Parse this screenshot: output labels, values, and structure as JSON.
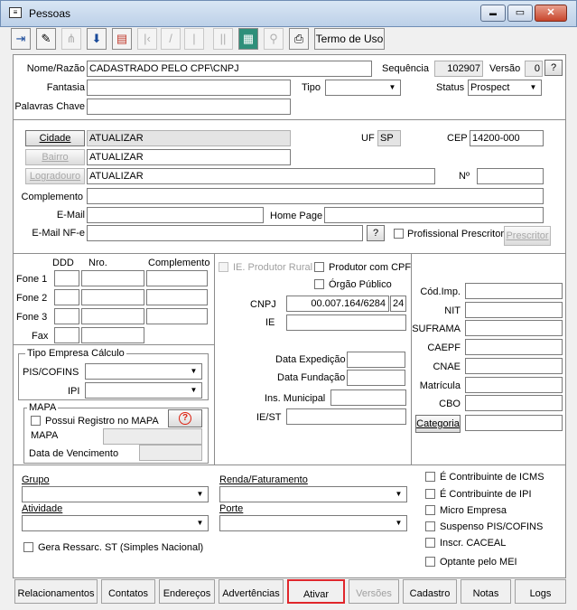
{
  "window": {
    "title": "Pessoas",
    "min": "▬",
    "max": "▭",
    "close": "✕"
  },
  "toolbar": {
    "termo_label": "Termo de Uso"
  },
  "identity": {
    "nome_label": "Nome/Razão",
    "nome_value": "CADASTRADO PELO CPF\\CNPJ",
    "sequencia_label": "Sequência",
    "sequencia_value": "102907",
    "versao_label": "Versão",
    "versao_value": "0",
    "help_label": "?",
    "fantasia_label": "Fantasia",
    "tipo_label": "Tipo",
    "status_label": "Status",
    "status_value": "Prospect",
    "palavras_label": "Palavras Chave"
  },
  "address": {
    "cidade_btn": "Cidade",
    "cidade_value": "ATUALIZAR",
    "uf_label": "UF",
    "uf_value": "SP",
    "cep_label": "CEP",
    "cep_value": "14200-000",
    "bairro_btn": "Bairro",
    "bairro_value": "ATUALIZAR",
    "logradouro_btn": "Logradouro",
    "logradouro_value": "ATUALIZAR",
    "numero_label": "Nº",
    "complemento_label": "Complemento",
    "email_label": "E-Mail",
    "homepage_label": "Home Page",
    "email_nfe_label": "E-Mail NF-e",
    "help_label": "?",
    "prof_prescritor_label": "Profissional Prescritor",
    "prescritor_btn": "Prescritor"
  },
  "phones": {
    "ddd_header": "DDD",
    "nro_header": "Nro.",
    "compl_header": "Complemento",
    "labels": [
      "Fone 1",
      "Fone 2",
      "Fone 3",
      "Fax"
    ]
  },
  "tipo_empresa": {
    "title": "Tipo Empresa Cálculo",
    "pis_label": "PIS/COFINS",
    "ipi_label": "IPI"
  },
  "mapa": {
    "title": "MAPA",
    "possui_label": "Possui Registro no MAPA",
    "mapa_label": "MAPA",
    "vencimento_label": "Data de Vencimento",
    "help_icon": "?"
  },
  "fiscal": {
    "ie_rural_label": "IE. Produtor Rural",
    "prod_cpf_label": "Produtor com CPF",
    "orgao_label": "Órgão Público",
    "cnpj_label": "CNPJ",
    "cnpj_value": "00.007.164/6284",
    "cnpj_digits": "24",
    "ie_label": "IE",
    "data_exp_label": "Data Expedição",
    "data_fund_label": "Data Fundação",
    "ins_mun_label": "Ins. Municipal",
    "iest_label": "IE/ST"
  },
  "codes": {
    "cod_imp_label": "Cód.Imp.",
    "nit_label": "NIT",
    "suframa_label": "SUFRAMA",
    "caepf_label": "CAEPF",
    "cnae_label": "CNAE",
    "matricula_label": "Matrícula",
    "cbo_label": "CBO",
    "categoria_btn": "Categoria"
  },
  "bottom": {
    "grupo_label": "Grupo",
    "renda_label": "Renda/Faturamento",
    "atividade_label": "Atividade",
    "porte_label": "Porte",
    "gera_label": "Gera Ressarc. ST (Simples Nacional)",
    "flags": [
      "É Contribuinte de ICMS",
      "É Contribuinte de IPI",
      "Micro Empresa",
      "Suspenso PIS/COFINS",
      "Inscr. CACEAL",
      "Optante pelo MEI"
    ]
  },
  "tabs": [
    "Relacionamentos",
    "Contatos",
    "Endereços",
    "Advertências",
    "Ativar",
    "Versões",
    "Cadastro",
    "Notas",
    "Logs"
  ]
}
